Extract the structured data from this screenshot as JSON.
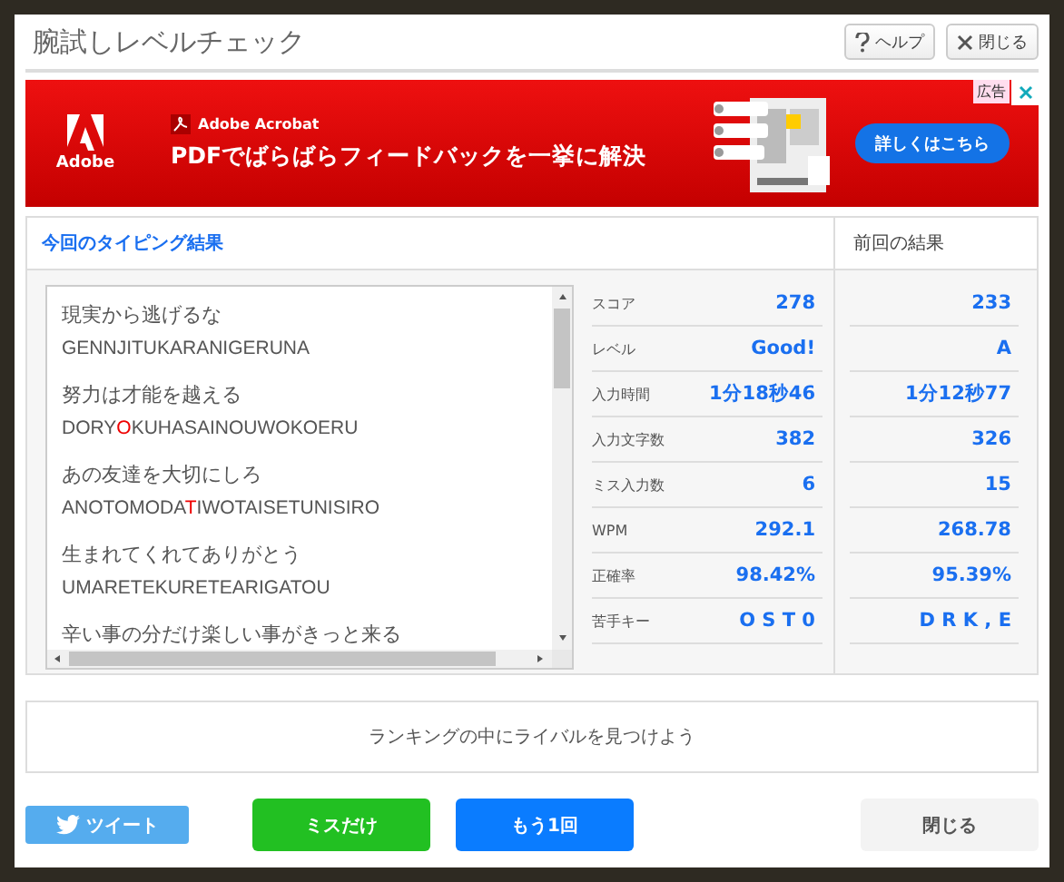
{
  "dialog": {
    "title": "腕試しレベルチェック",
    "help_button": "ヘルプ",
    "close_button": "閉じる"
  },
  "ad": {
    "badge": "広告",
    "brand": "Adobe",
    "product": "Adobe Acrobat",
    "headline": "PDFでばらばらフィードバックを一挙に解決",
    "cta": "詳しくはこちら"
  },
  "current": {
    "heading": "今回のタイピング結果",
    "lines": [
      {
        "text": "現実から逃げるな",
        "romaji": [
          {
            "text": "GENNJITUKARANIGERUNA",
            "miss": false
          }
        ]
      },
      {
        "text": "努力は才能を越える",
        "romaji": [
          {
            "text": "DORY",
            "miss": false
          },
          {
            "text": "O",
            "miss": true
          },
          {
            "text": "KUHASAINOUWOKOERU",
            "miss": false
          }
        ]
      },
      {
        "text": "あの友達を大切にしろ",
        "romaji": [
          {
            "text": "ANOTOMODA",
            "miss": false
          },
          {
            "text": "T",
            "miss": true
          },
          {
            "text": "IWOTAISETUNISIRO",
            "miss": false
          }
        ]
      },
      {
        "text": "生まれてくれてありがとう",
        "romaji": [
          {
            "text": "UMARETEKURETEARIGATOU",
            "miss": false
          }
        ]
      },
      {
        "text": "辛い事の分だけ楽しい事がきっと来る"
      }
    ]
  },
  "previous": {
    "heading": "前回の結果"
  },
  "stats": [
    {
      "label": "スコア",
      "current": "278",
      "previous": "233"
    },
    {
      "label": "レベル",
      "current": "Good!",
      "previous": "A"
    },
    {
      "label": "入力時間",
      "current": "1分18秒46",
      "previous": "1分12秒77"
    },
    {
      "label": "入力文字数",
      "current": "382",
      "previous": "326"
    },
    {
      "label": "ミス入力数",
      "current": "6",
      "previous": "15"
    },
    {
      "label": "WPM",
      "current": "292.1",
      "previous": "268.78"
    },
    {
      "label": "正確率",
      "current": "98.42%",
      "previous": "95.39%"
    },
    {
      "label": "苦手キー",
      "current": "O S T 0",
      "previous": "D R K , E"
    }
  ],
  "ranking_link": "ランキングの中にライバルを見つけよう",
  "buttons": [
    {
      "kind": "tweet",
      "label": "ツイート"
    },
    {
      "kind": "green",
      "label": "ミスだけ"
    },
    {
      "kind": "blue",
      "label": "もう1回"
    },
    {
      "kind": "close",
      "label": "閉じる"
    }
  ]
}
